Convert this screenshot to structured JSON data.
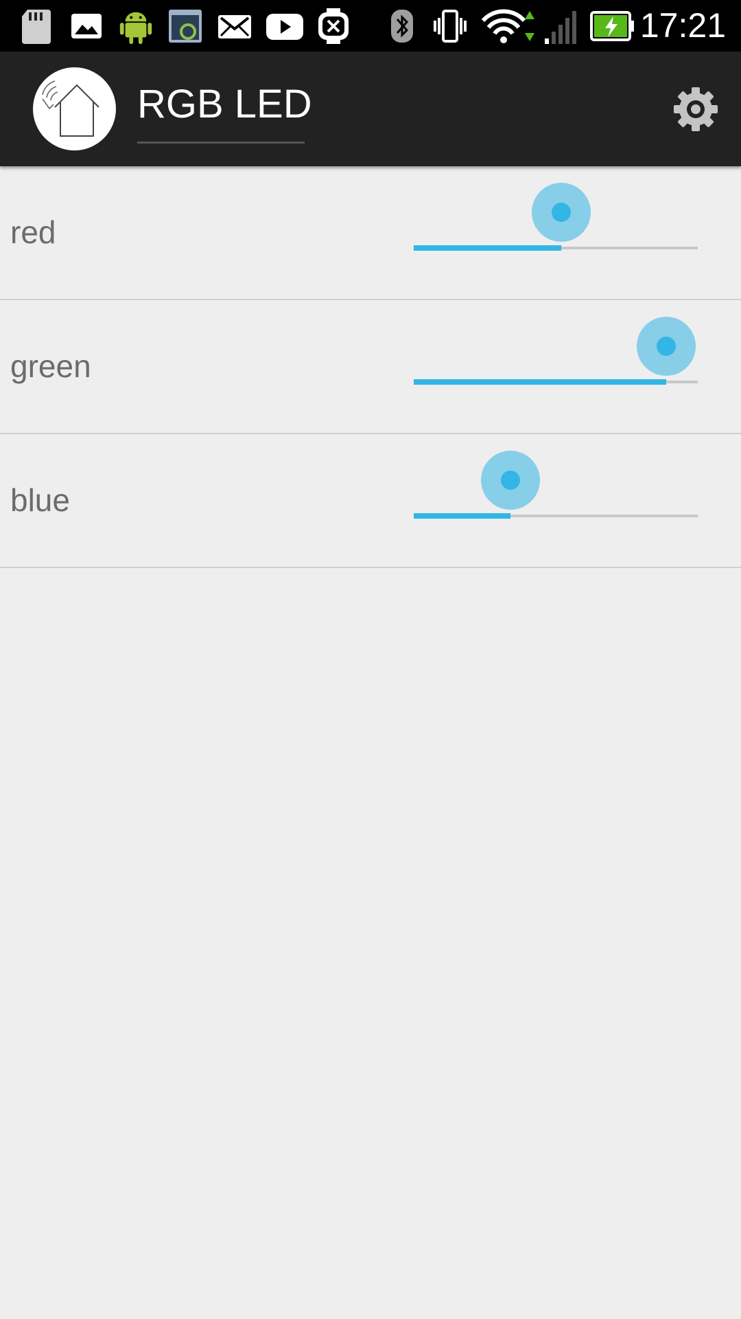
{
  "status_bar": {
    "time": "17:21",
    "icons": [
      "sd-card-icon",
      "image-icon",
      "android-icon",
      "sync-app-icon",
      "mail-icon",
      "youtube-icon",
      "smartwatch-icon",
      "bluetooth-icon",
      "vibrate-icon",
      "wifi-icon",
      "cell-signal-icon",
      "battery-charging-icon"
    ]
  },
  "action_bar": {
    "title": "RGB LED",
    "logo_icon": "home-wifi-logo-icon",
    "settings_icon": "gear-icon"
  },
  "sliders": [
    {
      "label": "red",
      "value": 0.52
    },
    {
      "label": "green",
      "value": 0.89
    },
    {
      "label": "blue",
      "value": 0.34
    }
  ],
  "colors": {
    "accent": "#33b5e5",
    "action_bar": "#222222",
    "background": "#eeeeee"
  }
}
